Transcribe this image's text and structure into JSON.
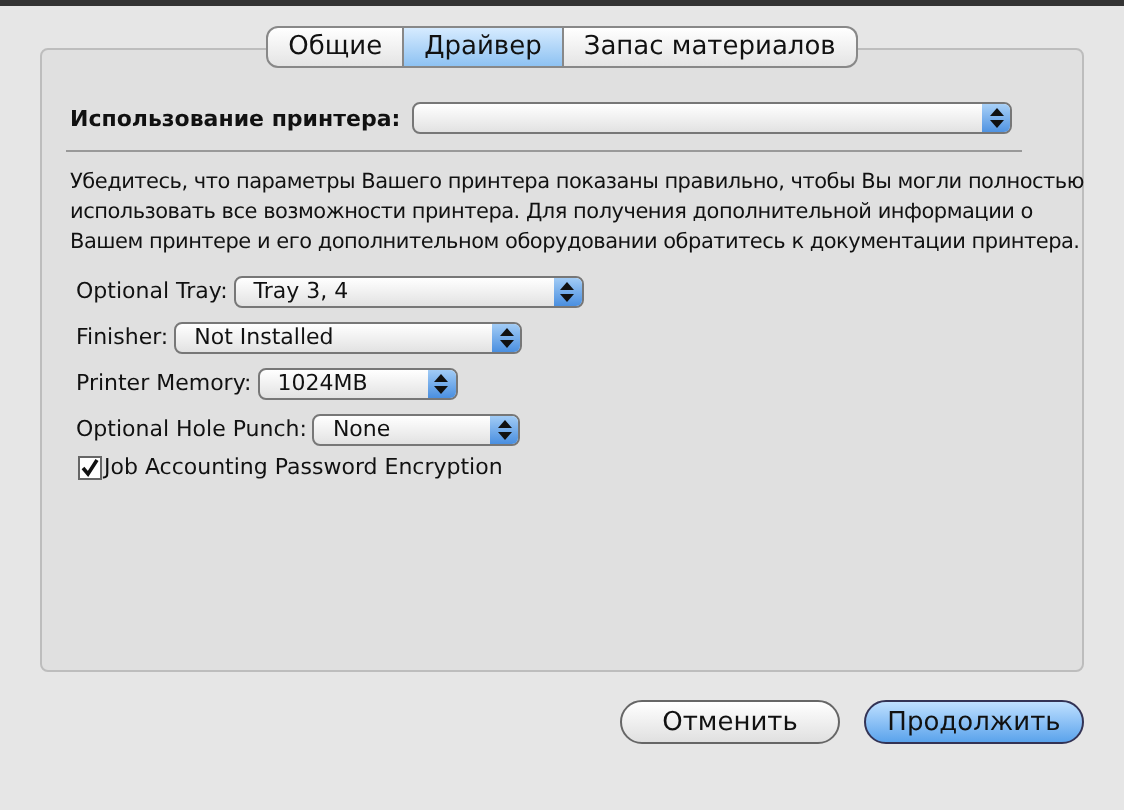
{
  "tabs": [
    {
      "label": "Общие",
      "selected": false
    },
    {
      "label": "Драйвер",
      "selected": true
    },
    {
      "label": "Запас материалов",
      "selected": false
    }
  ],
  "usage": {
    "label": "Использование принтера:"
  },
  "description": "Убедитесь, что параметры Вашего принтера показаны правильно, чтобы Вы могли полностью использовать все возможности принтера. Для получения дополнительной информации о Вашем принтере и его дополнительном оборудовании обратитесь к документации принтера.",
  "options": [
    {
      "label": "Optional Tray:",
      "value": "Tray 3, 4"
    },
    {
      "label": "Finisher:",
      "value": "Not Installed"
    },
    {
      "label": "Printer Memory:",
      "value": "1024MB"
    },
    {
      "label": "Optional Hole Punch:",
      "value": "None"
    }
  ],
  "checkbox": {
    "label": "Job Accounting Password Encryption",
    "checked": true
  },
  "buttons": [
    {
      "label": "Отменить",
      "kind": "cancel"
    },
    {
      "label": "Продолжить",
      "kind": "default"
    }
  ]
}
